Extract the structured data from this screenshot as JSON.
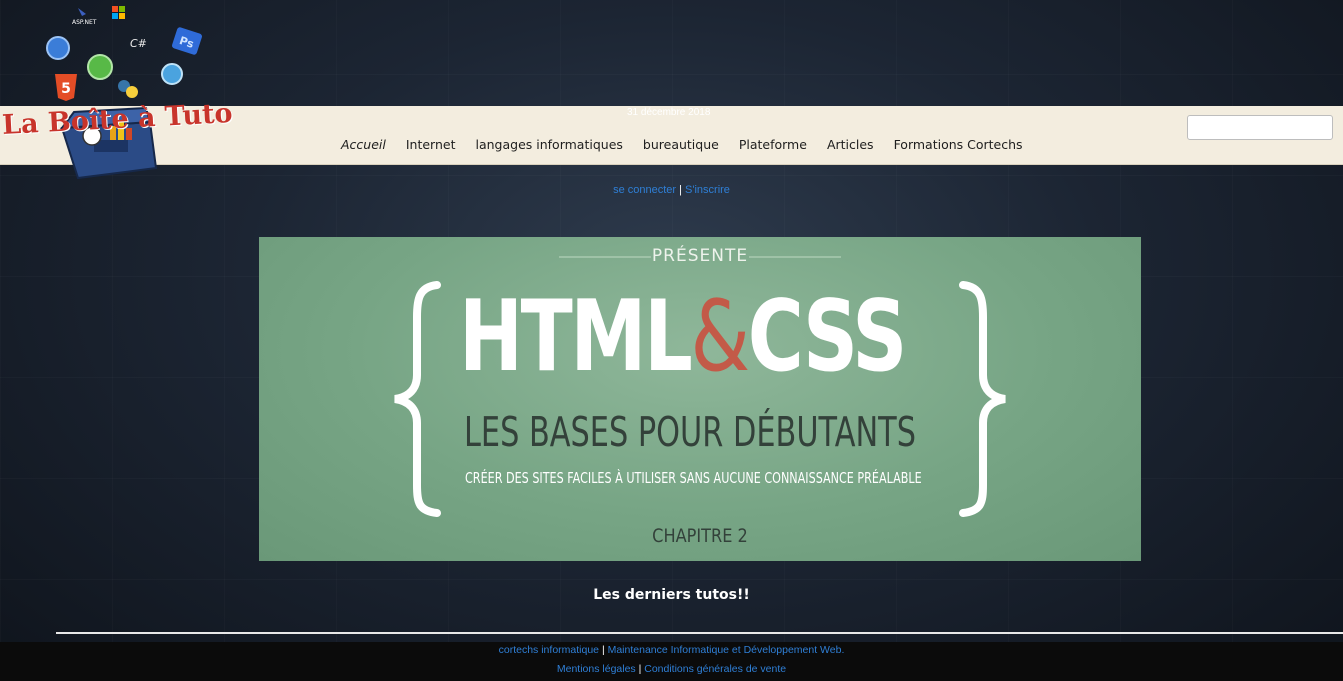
{
  "header": {
    "logo_text": "La Boîte à Tuto",
    "date": "31 décembre 2018"
  },
  "nav": {
    "items": [
      {
        "label": "Accueil",
        "active": true
      },
      {
        "label": "Internet"
      },
      {
        "label": "langages informatiques"
      },
      {
        "label": "bureautique"
      },
      {
        "label": "Plateforme"
      },
      {
        "label": "Articles"
      },
      {
        "label": "Formations Cortechs"
      }
    ],
    "search_value": ""
  },
  "auth": {
    "login": "se connecter",
    "separator": "|",
    "register": "S'inscrire"
  },
  "banner": {
    "presente": "PRÉSENTE",
    "html": "HTML",
    "amp": "&",
    "css": "CSS",
    "subtitle": "LES BASES POUR DÉBUTANTS",
    "tagline": "CRÉER DES SITES FACILES À UTILISER SANS AUCUNE CONNAISSANCE PRÉALABLE",
    "chapter": "CHAPITRE 2"
  },
  "latest": {
    "heading": "Les derniers tutos!!"
  },
  "footer": {
    "company": "cortechs informatique",
    "tagline": "Maintenance Informatique et Développement Web.",
    "legal": "Mentions légales",
    "cgv": "Conditions générales de vente",
    "separator": "|"
  },
  "colors": {
    "link": "#2f7fd6",
    "navbar_bg": "#f3eddf",
    "banner_green": "#77a585",
    "logo_red": "#c8342b"
  }
}
